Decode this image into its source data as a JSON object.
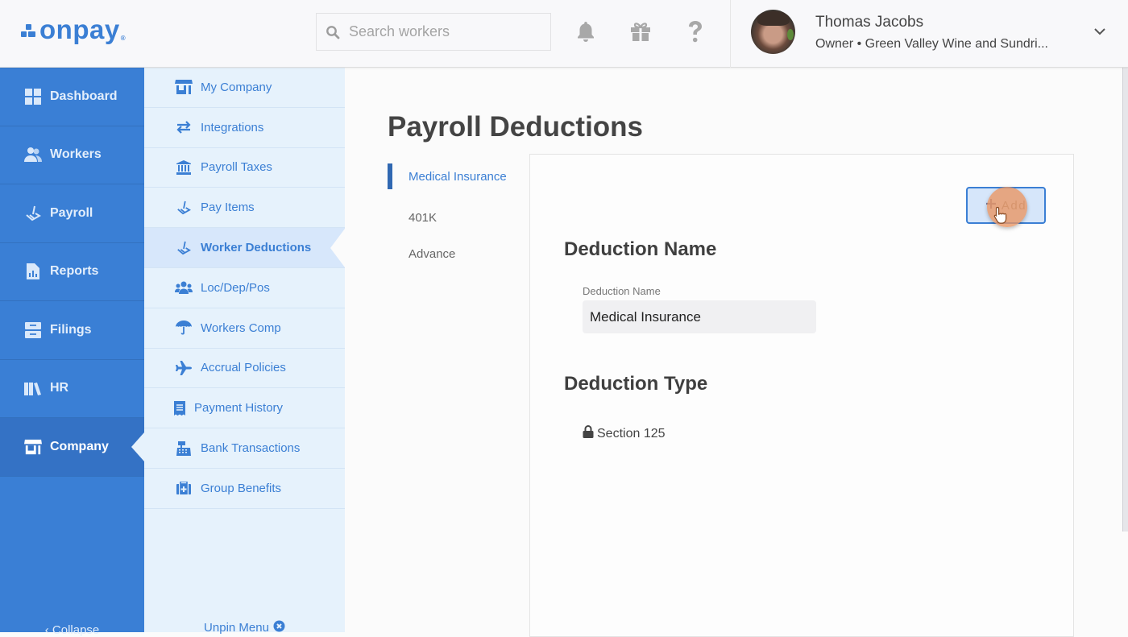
{
  "brand": {
    "name": "onpay",
    "registered": "®",
    "color": "#3b7fd4"
  },
  "header": {
    "search": {
      "placeholder": "Search workers",
      "value": ""
    },
    "icons": [
      "bell-icon",
      "gift-icon",
      "help-icon"
    ],
    "user": {
      "name": "Thomas Jacobs",
      "role_company": "Owner • Green Valley Wine and Sundri..."
    }
  },
  "nav": {
    "items": [
      {
        "label": "Dashboard",
        "icon": "dashboard-icon",
        "active": false
      },
      {
        "label": "Workers",
        "icon": "workers-icon",
        "active": false
      },
      {
        "label": "Payroll",
        "icon": "payroll-icon",
        "active": false
      },
      {
        "label": "Reports",
        "icon": "reports-icon",
        "active": false
      },
      {
        "label": "Filings",
        "icon": "filings-icon",
        "active": false
      },
      {
        "label": "HR",
        "icon": "hr-icon",
        "active": false
      },
      {
        "label": "Company",
        "icon": "company-icon",
        "active": true
      }
    ],
    "collapse_label": "‹ Collapse"
  },
  "subnav": {
    "items": [
      {
        "label": "My Company",
        "icon": "store-icon",
        "active": false
      },
      {
        "label": "Integrations",
        "icon": "exchange-icon",
        "active": false
      },
      {
        "label": "Payroll Taxes",
        "icon": "bank-icon",
        "active": false
      },
      {
        "label": "Pay Items",
        "icon": "pay-items-icon",
        "active": false
      },
      {
        "label": "Worker Deductions",
        "icon": "deductions-icon",
        "active": true
      },
      {
        "label": "Loc/Dep/Pos",
        "icon": "users-icon",
        "active": false
      },
      {
        "label": "Workers Comp",
        "icon": "umbrella-icon",
        "active": false
      },
      {
        "label": "Accrual Policies",
        "icon": "plane-icon",
        "active": false
      },
      {
        "label": "Payment History",
        "icon": "receipt-icon",
        "active": false
      },
      {
        "label": "Bank Transactions",
        "icon": "cash-register-icon",
        "active": false
      },
      {
        "label": "Group Benefits",
        "icon": "medkit-icon",
        "active": false
      }
    ],
    "unpin_label": "Unpin Menu"
  },
  "main": {
    "title": "Payroll Deductions",
    "tabs": [
      {
        "label": "Medical Insurance",
        "active": true
      },
      {
        "label": "401K",
        "active": false
      },
      {
        "label": "Advance",
        "active": false
      }
    ],
    "add_button": "Add",
    "deduction_name_heading": "Deduction Name",
    "deduction_name_label": "Deduction Name",
    "deduction_name_value": "Medical Insurance",
    "deduction_type_heading": "Deduction Type",
    "deduction_type_value": "Section 125"
  }
}
